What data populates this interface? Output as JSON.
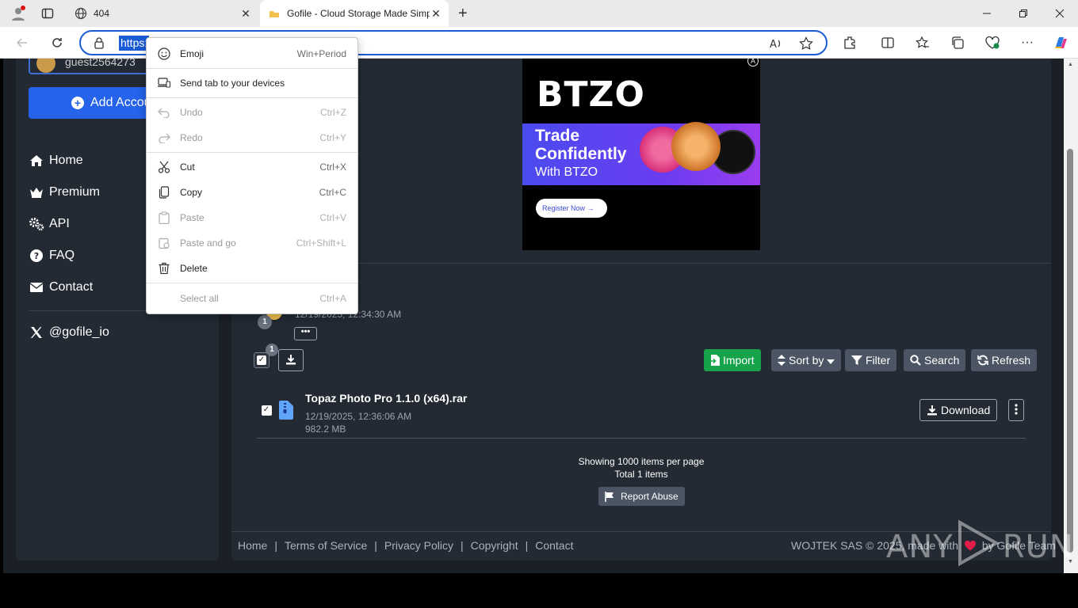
{
  "browser": {
    "tabs": [
      {
        "title": "404"
      },
      {
        "title": "Gofile - Cloud Storage Made Simp"
      }
    ],
    "url_selected": "https:"
  },
  "sidebar": {
    "account_name": "guest2564273",
    "add_account": "Add Account",
    "items": [
      {
        "label": "Home"
      },
      {
        "label": "Premium"
      },
      {
        "label": "API"
      },
      {
        "label": "FAQ"
      },
      {
        "label": "Contact"
      }
    ],
    "twitter": "@gofile_io"
  },
  "ad": {
    "logo": "BTZO",
    "line1": "Trade",
    "line2": "Confidently",
    "line3": "With BTZO",
    "button": "Register Now"
  },
  "folder": {
    "badge": "1",
    "date": "12/19/2025, 12:34:30 AM",
    "more": "•••"
  },
  "toolbar": {
    "select_badge": "1",
    "import": "Import",
    "sort_by": "Sort by",
    "filter": "Filter",
    "search": "Search",
    "refresh": "Refresh"
  },
  "files": [
    {
      "name": "Topaz Photo Pro 1.1.0 (x64).rar",
      "date": "12/19/2025, 12:36:06 AM",
      "size": "982.2 MB",
      "download": "Download"
    }
  ],
  "pager": {
    "per_page": "Showing 1000 items per page",
    "total": "Total 1 items",
    "report": "Report Abuse"
  },
  "footer": {
    "links": [
      "Home",
      "Terms of Service",
      "Privacy Policy",
      "Copyright",
      "Contact"
    ],
    "separator": "|",
    "copyright_a": "WOJTEK SAS © 2025, made with",
    "copyright_b": "by Gofile Team"
  },
  "context_menu": [
    {
      "label": "Emoji",
      "shortcut": "Win+Period",
      "disabled": false
    },
    {
      "label": "Send tab to your devices",
      "shortcut": "",
      "disabled": false
    },
    {
      "label": "Undo",
      "shortcut": "Ctrl+Z",
      "disabled": true
    },
    {
      "label": "Redo",
      "shortcut": "Ctrl+Y",
      "disabled": true
    },
    {
      "label": "Cut",
      "shortcut": "Ctrl+X",
      "disabled": false
    },
    {
      "label": "Copy",
      "shortcut": "Ctrl+C",
      "disabled": false
    },
    {
      "label": "Paste",
      "shortcut": "Ctrl+V",
      "disabled": true
    },
    {
      "label": "Paste and go",
      "shortcut": "Ctrl+Shift+L",
      "disabled": true
    },
    {
      "label": "Delete",
      "shortcut": "",
      "disabled": false
    },
    {
      "label": "Select all",
      "shortcut": "Ctrl+A",
      "disabled": true
    }
  ],
  "watermark": {
    "left": "ANY",
    "right": "RUN"
  },
  "colors": {
    "accent": "#2563eb",
    "success": "#16a34a",
    "page_bg": "#1b2027",
    "panel": "#232a33"
  }
}
